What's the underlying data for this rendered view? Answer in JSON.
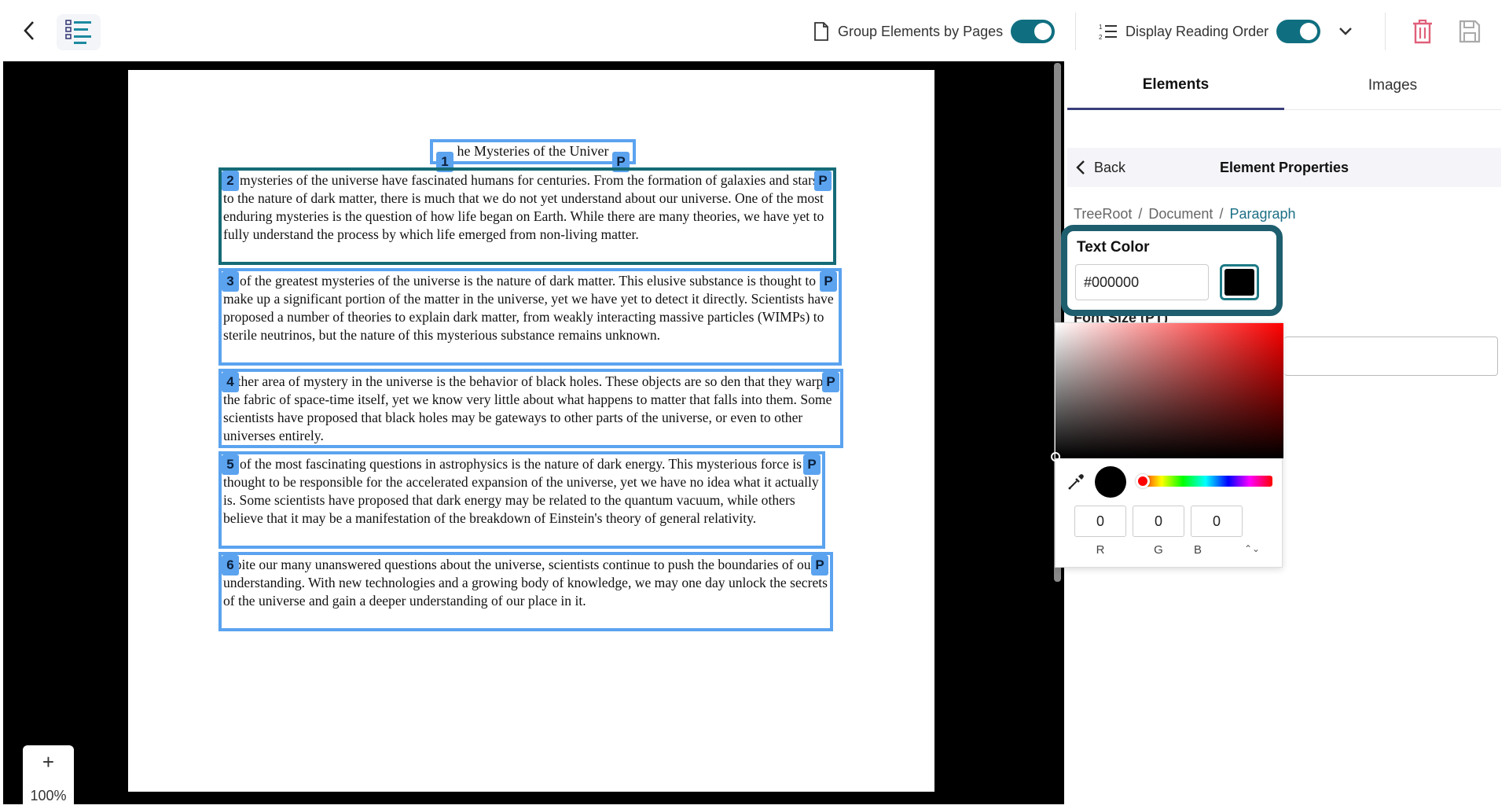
{
  "toolbar": {
    "group_by_pages_label": "Group Elements by Pages",
    "display_reading_order_label": "Display Reading Order",
    "group_by_pages_on": true,
    "reading_order_on": true
  },
  "document": {
    "blocks": [
      {
        "num": "1",
        "type": "P",
        "text": "he Mysteries of the Univer"
      },
      {
        "num": "2",
        "type": "P",
        "text": "ne mysteries of the universe have fascinated humans for centuries. From the formation of galaxies and stars to the nature of dark matter, there is much that we do not yet understand about our universe. One of the most enduring mysteries is the question of how life began on Earth. While there are many theories, we have yet to fully understand the process by which life emerged from non-living matter."
      },
      {
        "num": "3",
        "type": "P",
        "text": "ne of the greatest mysteries of the universe is the nature of dark matter. This elusive substance is thought to make up a significant portion of the matter in the universe, yet we have yet to detect it directly. Scientists have proposed a number of theories to explain dark matter, from weakly interacting massive particles (WIMPs) to sterile neutrinos, but the nature of this mysterious substance remains unknown."
      },
      {
        "num": "4",
        "type": "P",
        "text": "nother area of mystery in the universe is the behavior of black holes. These objects are so den that they warp the fabric of space-time itself, yet we know very little about what happens to matter that falls into them. Some scientists have proposed that black holes may be gateways to other parts of the universe, or even to other universes entirely."
      },
      {
        "num": "5",
        "type": "P",
        "text": "ne of the most fascinating questions in astrophysics is the nature of dark energy. This mysterious force is thought to be responsible for the accelerated expansion of the universe, yet we have no idea what it actually is. Some scientists have proposed that dark energy may be related to the quantum vacuum, while others believe that it may be a manifestation of the breakdown of Einstein's theory of general relativity."
      },
      {
        "num": "6",
        "type": "P",
        "text": "espite our many unanswered questions about the universe, scientists continue to push the boundaries of our understanding. With new technologies and a growing body of knowledge, we may one day unlock the secrets of the universe and gain a deeper understanding of our place in it."
      }
    ]
  },
  "zoom": {
    "plus": "+",
    "value": "100%",
    "minus": "−"
  },
  "panel": {
    "tabs": [
      "Elements",
      "Images"
    ],
    "active_tab": "Elements",
    "back_label": "Back",
    "title": "Element Properties",
    "breadcrumb": [
      "TreeRoot",
      "/",
      "Document",
      "/",
      "Paragraph"
    ],
    "text_color_label": "Text Color",
    "text_color_value": "#000000",
    "font_size_label": "Font Size (PT)"
  },
  "picker": {
    "r": "0",
    "g": "0",
    "b": "0",
    "r_label": "R",
    "g_label": "G",
    "b_label": "B",
    "mode_toggle": "⌃⌄",
    "current_color": "#000000",
    "hue_color": "#ff0000"
  },
  "colors": {
    "accent": "#0f6f80",
    "selected_border": "#156b77",
    "block_border": "#5ba3ef",
    "delete_icon": "#e0607a"
  },
  "icons": {
    "back": "chevron-left-icon",
    "logo": "list-structure-icon",
    "page": "page-icon",
    "reading_order": "numbered-list-icon",
    "chevron": "chevron-down-icon",
    "delete": "trash-icon",
    "save": "save-icon",
    "eyedropper": "eyedropper-icon"
  }
}
